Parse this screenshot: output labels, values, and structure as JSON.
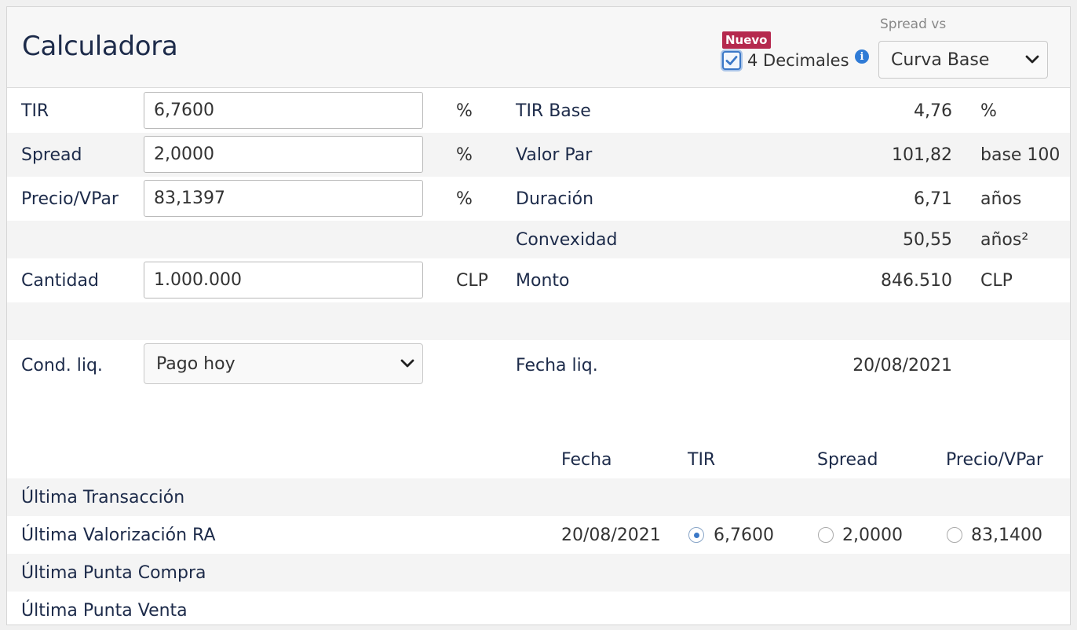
{
  "header": {
    "title": "Calculadora",
    "badge": "Nuevo",
    "decimals_label": "4 Decimales",
    "decimals_checked": true,
    "info_icon": "i",
    "spread_vs_label": "Spread vs",
    "spread_vs_value": "Curva Base"
  },
  "left": {
    "tir_label": "TIR",
    "tir_value": "6,7600",
    "tir_unit": "%",
    "spread_label": "Spread",
    "spread_value": "2,0000",
    "spread_unit": "%",
    "precio_label": "Precio/VPar",
    "precio_value": "83,1397",
    "precio_unit": "%",
    "cantidad_label": "Cantidad",
    "cantidad_value": "1.000.000",
    "cantidad_unit": "CLP",
    "cond_label": "Cond. liq.",
    "cond_value": "Pago hoy"
  },
  "right": {
    "tir_base_label": "TIR Base",
    "tir_base_value": "4,76",
    "tir_base_unit": "%",
    "valor_par_label": "Valor Par",
    "valor_par_value": "101,82",
    "valor_par_unit": "base 100",
    "duracion_label": "Duración",
    "duracion_value": "6,71",
    "duracion_unit": "años",
    "convexidad_label": "Convexidad",
    "convexidad_value": "50,55",
    "convexidad_unit": "años²",
    "monto_label": "Monto",
    "monto_value": "846.510",
    "monto_unit": "CLP",
    "fecha_liq_label": "Fecha liq.",
    "fecha_liq_value": "20/08/2021"
  },
  "table": {
    "headers": {
      "fecha": "Fecha",
      "tir": "TIR",
      "spread": "Spread",
      "precio": "Precio/VPar"
    },
    "rows": [
      {
        "label": "Última Transacción"
      },
      {
        "label": "Última Valorización RA",
        "fecha": "20/08/2021",
        "tir": "6,7600",
        "spread": "2,0000",
        "precio": "83,1400",
        "selected": "tir"
      },
      {
        "label": "Última Punta Compra"
      },
      {
        "label": "Última Punta Venta"
      }
    ]
  },
  "colors": {
    "accent": "#3b78c7",
    "badge": "#b5294e",
    "text": "#1d2b4a"
  }
}
